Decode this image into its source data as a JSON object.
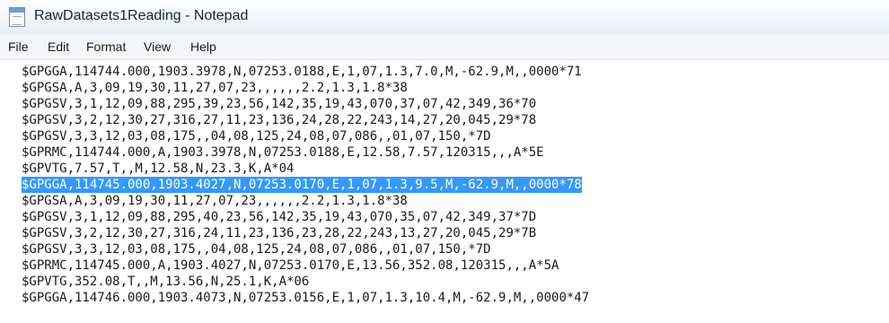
{
  "window": {
    "title": "RawDatasets1Reading - Notepad"
  },
  "menu": {
    "items": [
      "File",
      "Edit",
      "Format",
      "View",
      "Help"
    ]
  },
  "editor": {
    "lines": [
      "$GPGGA,114744.000,1903.3978,N,07253.0188,E,1,07,1.3,7.0,M,-62.9,M,,0000*71",
      "$GPGSA,A,3,09,19,30,11,27,07,23,,,,,,2.2,1.3,1.8*38",
      "$GPGSV,3,1,12,09,88,295,39,23,56,142,35,19,43,070,37,07,42,349,36*70",
      "$GPGSV,3,2,12,30,27,316,27,11,23,136,24,28,22,243,14,27,20,045,29*78",
      "$GPGSV,3,3,12,03,08,175,,04,08,125,24,08,07,086,,01,07,150,*7D",
      "$GPRMC,114744.000,A,1903.3978,N,07253.0188,E,12.58,7.57,120315,,,A*5E",
      "$GPVTG,7.57,T,,M,12.58,N,23.3,K,A*04",
      "$GPGGA,114745.000,1903.4027,N,07253.0170,E,1,07,1.3,9.5,M,-62.9,M,,0000*78",
      "$GPGSA,A,3,09,19,30,11,27,07,23,,,,,,2.2,1.3,1.8*38",
      "$GPGSV,3,1,12,09,88,295,40,23,56,142,35,19,43,070,35,07,42,349,37*7D",
      "$GPGSV,3,2,12,30,27,316,24,11,23,136,23,28,22,243,13,27,20,045,29*7B",
      "$GPGSV,3,3,12,03,08,175,,04,08,125,24,08,07,086,,01,07,150,*7D",
      "$GPRMC,114745.000,A,1903.4027,N,07253.0170,E,13.56,352.08,120315,,,A*5A",
      "$GPVTG,352.08,T,,M,13.56,N,25.1,K,A*06",
      "$GPGGA,114746.000,1903.4073,N,07253.0156,E,1,07,1.3,10.4,M,-62.9,M,,0000*47"
    ],
    "selected_line_index": 7,
    "selection_color": "#3399ff"
  }
}
